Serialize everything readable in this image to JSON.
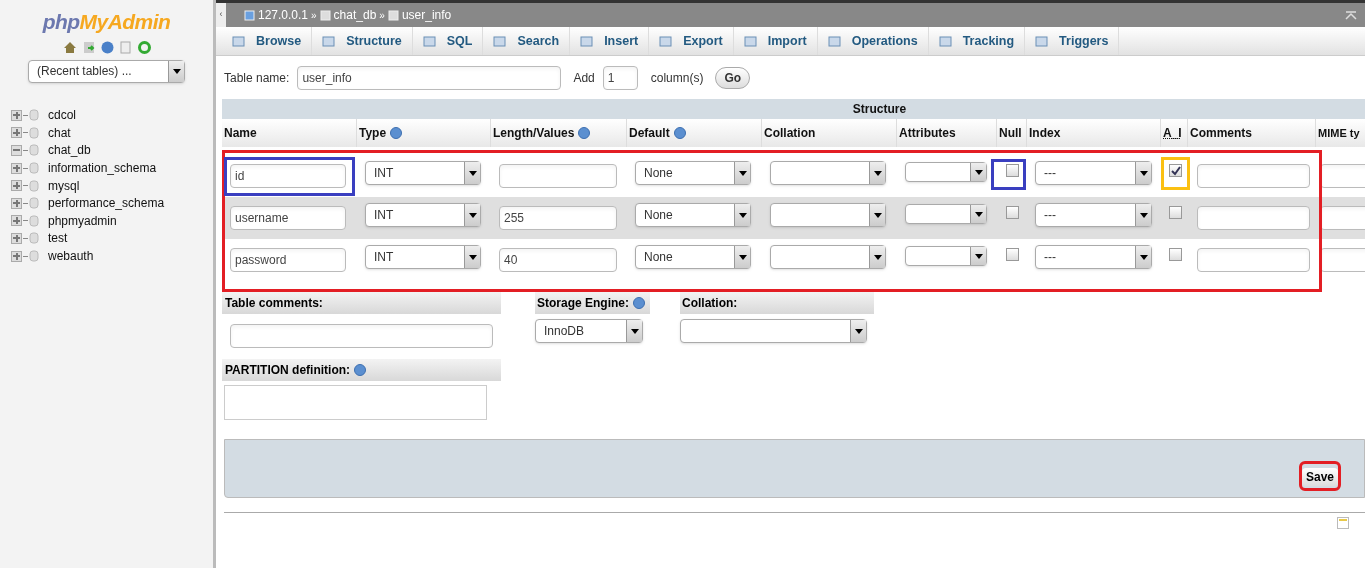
{
  "sidebar": {
    "logo_left": "php",
    "logo_right": "MyAdmin",
    "recent_tables": "(Recent tables) ...",
    "databases": [
      {
        "name": "cdcol",
        "expanded": false
      },
      {
        "name": "chat",
        "expanded": false
      },
      {
        "name": "chat_db",
        "expanded": true
      },
      {
        "name": "information_schema",
        "expanded": false
      },
      {
        "name": "mysql",
        "expanded": false
      },
      {
        "name": "performance_schema",
        "expanded": false
      },
      {
        "name": "phpmyadmin",
        "expanded": false
      },
      {
        "name": "test",
        "expanded": false
      },
      {
        "name": "webauth",
        "expanded": false
      }
    ]
  },
  "collapse_handle": "‹",
  "breadcrumb": [
    "127.0.0.1",
    "chat_db",
    "user_info"
  ],
  "breadcrumb_separator": "»",
  "tabs": [
    {
      "label": "Browse",
      "selected": false
    },
    {
      "label": "Structure",
      "selected": false
    },
    {
      "label": "SQL",
      "selected": false
    },
    {
      "label": "Search",
      "selected": false
    },
    {
      "label": "Insert",
      "selected": false
    },
    {
      "label": "Export",
      "selected": false
    },
    {
      "label": "Import",
      "selected": false
    },
    {
      "label": "Operations",
      "selected": false
    },
    {
      "label": "Tracking",
      "selected": false
    },
    {
      "label": "Triggers",
      "selected": false
    }
  ],
  "table_name": {
    "label": "Table name:",
    "value": "user_info",
    "add_label": "Add",
    "add_value": "1",
    "columns_label": "column(s)",
    "go": "Go"
  },
  "structure_title": "Structure",
  "columns": [
    {
      "label": "Name",
      "help": false
    },
    {
      "label": "Type",
      "help": true
    },
    {
      "label": "Length/Values",
      "help": true
    },
    {
      "label": "Default",
      "help": true
    },
    {
      "label": "Collation",
      "help": false
    },
    {
      "label": "Attributes",
      "help": false
    },
    {
      "label": "Null",
      "help": false
    },
    {
      "label": "Index",
      "help": false
    },
    {
      "label": "A_I",
      "help": false
    },
    {
      "label": "Comments",
      "help": false
    },
    {
      "label": "MIME ty",
      "help": false
    }
  ],
  "rows": [
    {
      "name": "id",
      "type": "INT",
      "length": "",
      "default": "None",
      "null": false,
      "index": "---",
      "ai": true
    },
    {
      "name": "username",
      "type": "INT",
      "length": "255",
      "default": "None",
      "null": false,
      "index": "---",
      "ai": false
    },
    {
      "name": "password",
      "type": "INT",
      "length": "40",
      "default": "None",
      "null": false,
      "index": "---",
      "ai": false
    }
  ],
  "table_comments": {
    "label": "Table comments:"
  },
  "storage_engine": {
    "label": "Storage Engine:",
    "value": "InnoDB"
  },
  "collation": {
    "label": "Collation:"
  },
  "partition": {
    "label": "PARTITION definition:"
  },
  "save": "Save"
}
